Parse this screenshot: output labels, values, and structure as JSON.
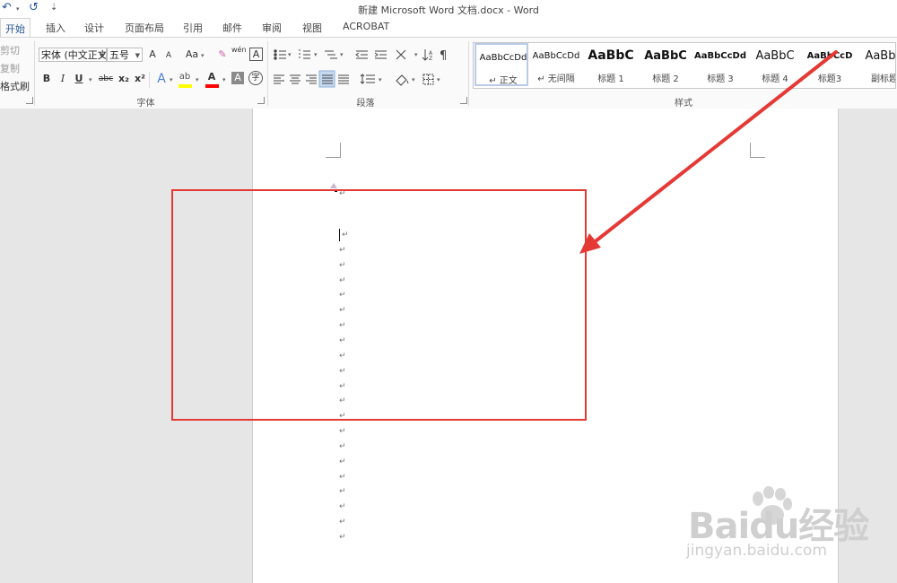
{
  "window": {
    "title": "新建 Microsoft Word 文档.docx - Word"
  },
  "quick_access": {
    "undo": "↶",
    "redo": "↺",
    "customize": "⇣"
  },
  "tabs": [
    "开始",
    "插入",
    "设计",
    "页面布局",
    "引用",
    "邮件",
    "审阅",
    "视图",
    "ACROBAT"
  ],
  "clipboard": {
    "cut": "剪切",
    "copy": "复制",
    "format_painter": "格式刷"
  },
  "font": {
    "font_name": "宋体 (中文正文)",
    "font_size": "五号",
    "group_label": "字体",
    "grow": "A",
    "shrink": "A",
    "case": "Aa",
    "phonetic": "wén",
    "bold": "B",
    "italic": "I",
    "underline": "U",
    "strike": "abc",
    "sub": "x₂",
    "sup": "x²",
    "effects": "A",
    "font_color": "A",
    "char_shade": "A",
    "enclose": "字"
  },
  "paragraph": {
    "group_label": "段落"
  },
  "styles": {
    "group_label": "样式",
    "items": [
      {
        "preview": "AaBbCcDd",
        "name": "↵ 正文"
      },
      {
        "preview": "AaBbCcDd",
        "name": "↵ 无间隔"
      },
      {
        "preview": "AaBbC",
        "name": "标题 1"
      },
      {
        "preview": "AaBbC",
        "name": "标题 2"
      },
      {
        "preview": "AaBbCcDd",
        "name": "标题 3"
      },
      {
        "preview": "AaBbC",
        "name": "标题 4"
      },
      {
        "preview": "AaBbCcD",
        "name": "标题3"
      },
      {
        "preview": "AaBbC",
        "name": "副标题"
      }
    ]
  },
  "document": {
    "paragraph_mark": "↵",
    "paragraph_count": 22
  },
  "watermark": {
    "brand": "Baidu经验",
    "url": "jingyan.baidu.com"
  },
  "colors": {
    "accent": "#2b579a",
    "annotation": "#e53935",
    "highlight_yellow": "#ffff00",
    "font_red": "#ff0000"
  }
}
